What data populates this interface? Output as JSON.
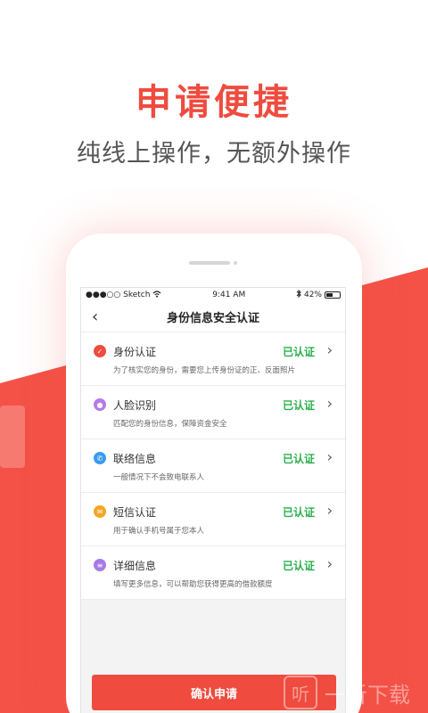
{
  "promo": {
    "headline": "申请便捷",
    "subline": "纯线上操作，无额外操作"
  },
  "statusbar": {
    "carrier": "●●●○○ Sketch",
    "time": "9:41 AM",
    "battery": "42%"
  },
  "nav": {
    "back_icon": "‹",
    "title": "身份信息安全认证"
  },
  "items": [
    {
      "title": "身份认证",
      "desc": "为了核实您的身份，需要您上传身份证的正、反面照片",
      "status": "已认证",
      "icon": "shield-icon",
      "color": "#ef4b3f",
      "glyph": "✓"
    },
    {
      "title": "人脸识别",
      "desc": "匹配您的身份信息，保障资金安全",
      "status": "已认证",
      "icon": "face-icon",
      "color": "#b47be8",
      "glyph": "●"
    },
    {
      "title": "联络信息",
      "desc": "一般情况下不会致电联系人",
      "status": "已认证",
      "icon": "phone-icon",
      "color": "#3a9bf0",
      "glyph": "✆"
    },
    {
      "title": "短信认证",
      "desc": "用于确认手机号属于您本人",
      "status": "已认证",
      "icon": "mail-icon",
      "color": "#f5a623",
      "glyph": "✉"
    },
    {
      "title": "详细信息",
      "desc": "填写更多信息，可以帮助您获得更高的借款额度",
      "status": "已认证",
      "icon": "document-icon",
      "color": "#a67be8",
      "glyph": "≡"
    }
  ],
  "confirm_label": "确认申请",
  "watermark": {
    "logo": "听",
    "text": "一听下载"
  },
  "colors": {
    "accent": "#ef4b3f",
    "verified": "#2bb04e"
  }
}
